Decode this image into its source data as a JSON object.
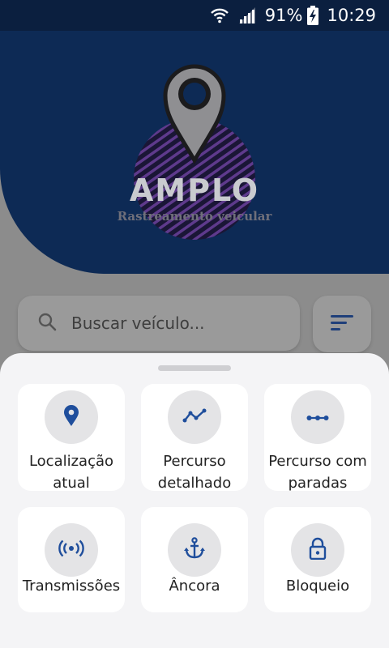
{
  "status_bar": {
    "battery": "91%",
    "time": "10:29"
  },
  "logo": {
    "title": "AMPLO",
    "subtitle": "Rastreamento veicular"
  },
  "search": {
    "placeholder": "Buscar veículo..."
  },
  "actions": [
    {
      "label": "Localização atual",
      "icon": "location-pin-icon"
    },
    {
      "label": "Percurso detalhado",
      "icon": "route-line-icon"
    },
    {
      "label": "Percurso com paradas",
      "icon": "route-stops-icon"
    },
    {
      "label": "Transmissões",
      "icon": "broadcast-icon"
    },
    {
      "label": "Âncora",
      "icon": "anchor-icon"
    },
    {
      "label": "Bloqueio",
      "icon": "lock-icon"
    }
  ],
  "colors": {
    "header": "#0d2a55",
    "accent": "#1f4e9c",
    "sheet": "#f4f4f6"
  }
}
